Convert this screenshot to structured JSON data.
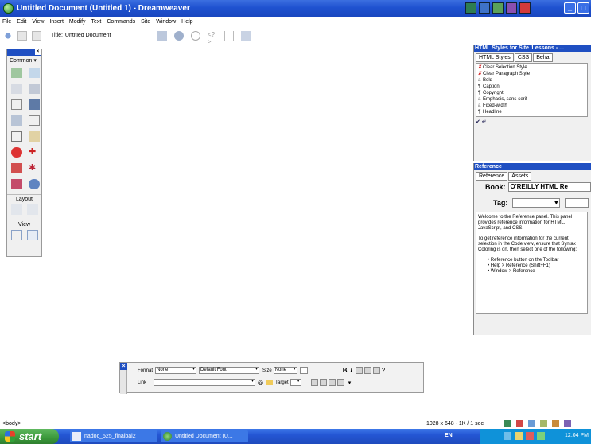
{
  "window": {
    "title": "Untitled Document (Untitled 1) - Dreamweaver"
  },
  "menu": [
    "File",
    "Edit",
    "View",
    "Insert",
    "Modify",
    "Text",
    "Commands",
    "Site",
    "Window",
    "Help"
  ],
  "doc_toolbar": {
    "title_label": "Title:",
    "title_value": "Untitled Document"
  },
  "objects_panel": {
    "category": "Common",
    "layout_label": "Layout",
    "view_label": "View"
  },
  "properties": {
    "format_label": "Format",
    "format_value": "None",
    "font_value": "Default Font",
    "size_label": "Size",
    "size_value": "None",
    "link_label": "Link",
    "target_label": "Target",
    "bold_label": "B",
    "italic_label": "I"
  },
  "html_styles_panel": {
    "header": "HTML Styles for Site 'Lessons - ...",
    "tabs": [
      "HTML Styles",
      "CSS",
      "Beha"
    ],
    "items": [
      "Clear Selection Style",
      "Clear Paragraph Style",
      "Bold",
      "Caption",
      "Copyright",
      "Emphasis, sans-serif",
      "Fixed-width",
      "Headline"
    ]
  },
  "reference_panel": {
    "header": "Reference",
    "tabs": [
      "Reference",
      "Assets"
    ],
    "book_label": "Book:",
    "book_value": "O'REILLY HTML Re",
    "tag_label": "Tag:",
    "text_p1": "Welcome to the Reference panel. This panel provides reference information for HTML, JavaScript, and CSS.",
    "text_p2": "To get reference information for the current selection in the Code view, ensure that Syntax Coloring is on, then select one of the following:",
    "bullets": [
      "Reference button on the Toolbar",
      "Help > Reference (Shift+F1)",
      "Window > Reference"
    ]
  },
  "status_bar": {
    "tag": "<body>",
    "size": "1028 x 648 - 1K / 1 sec"
  },
  "taskbar": {
    "start": "start",
    "tasks": [
      "nadoc_525_finalbal2",
      "Untitled Document (U..."
    ],
    "lang": "EN",
    "clock": "12:04 PM"
  }
}
